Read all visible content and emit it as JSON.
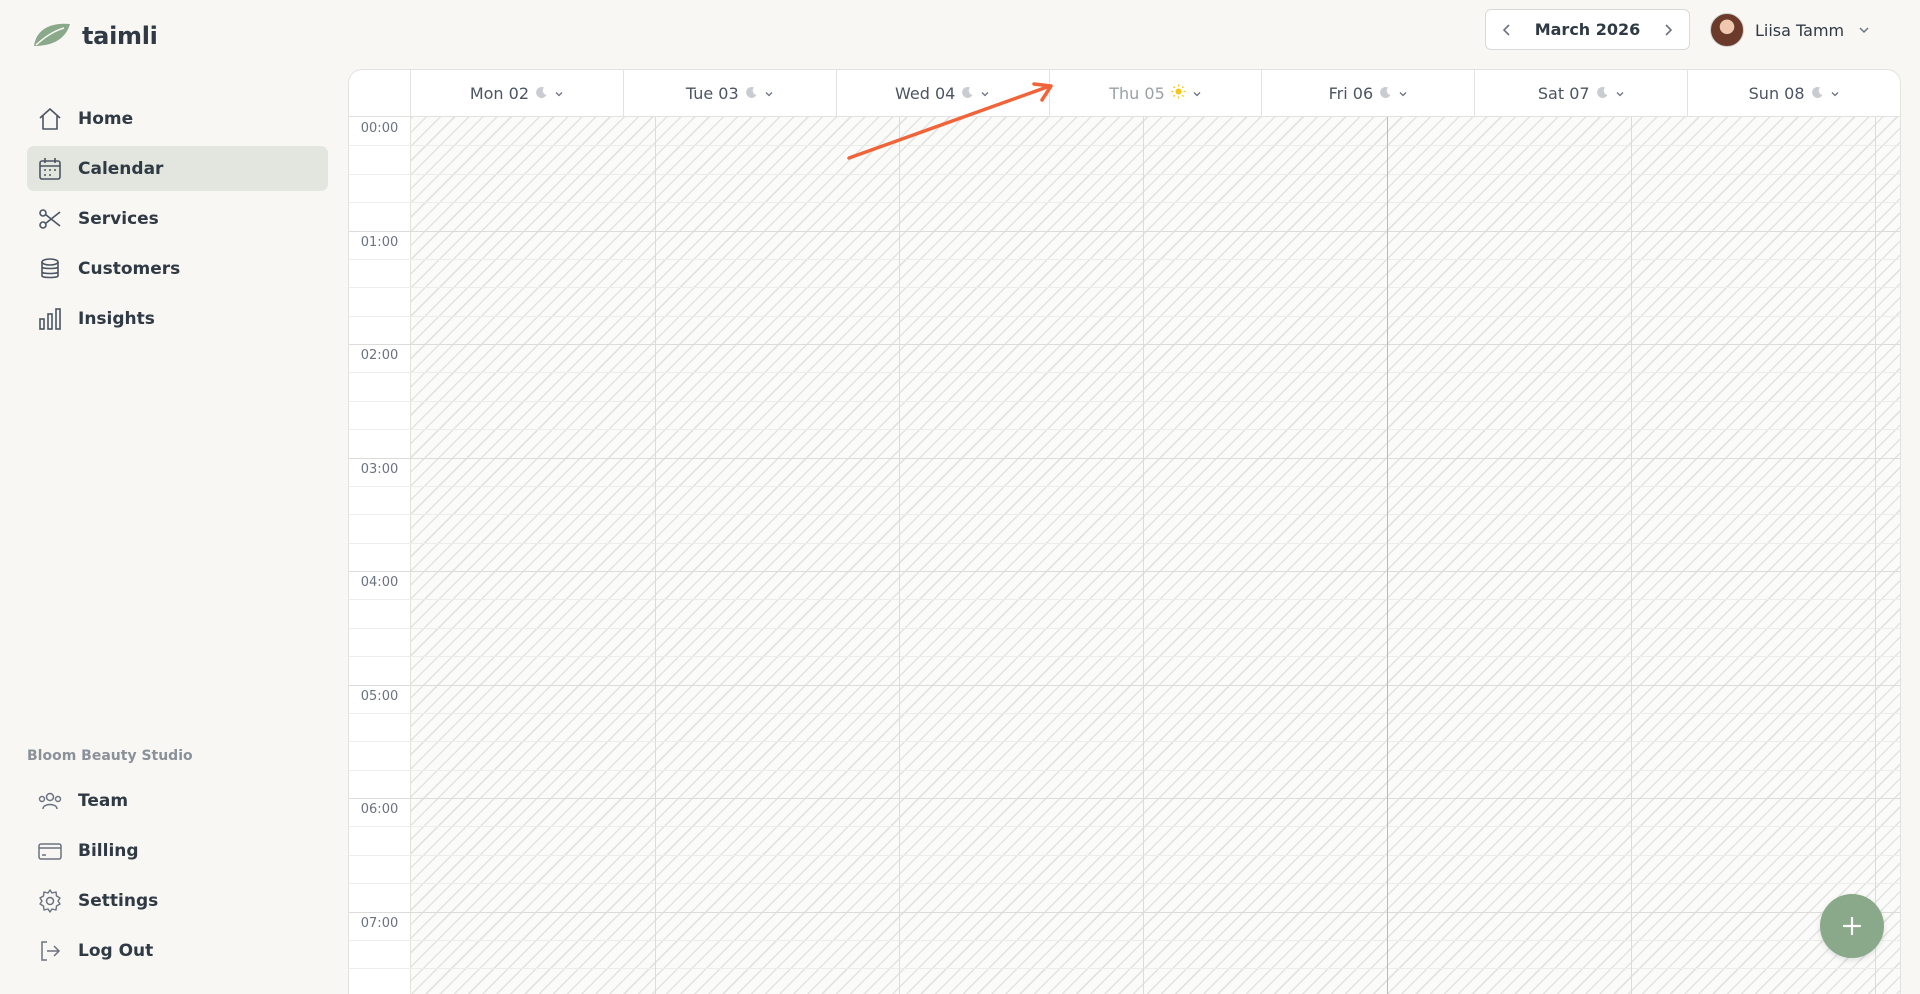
{
  "app": {
    "name": "taimli"
  },
  "sidebar": {
    "main_items": [
      {
        "label": "Home",
        "icon": "home-icon"
      },
      {
        "label": "Calendar",
        "icon": "calendar-icon",
        "active": true
      },
      {
        "label": "Services",
        "icon": "scissors-icon"
      },
      {
        "label": "Customers",
        "icon": "database-icon"
      },
      {
        "label": "Insights",
        "icon": "bar-chart-icon"
      }
    ],
    "studio_name": "Bloom Beauty Studio",
    "bottom_items": [
      {
        "label": "Team",
        "icon": "team-icon"
      },
      {
        "label": "Billing",
        "icon": "credit-card-icon"
      },
      {
        "label": "Settings",
        "icon": "gear-icon"
      },
      {
        "label": "Log Out",
        "icon": "logout-icon"
      }
    ]
  },
  "header": {
    "month_label": "March 2026",
    "user_name": "Liisa Tamm"
  },
  "calendar": {
    "days": [
      {
        "label": "Mon 02",
        "icon": "moon-icon"
      },
      {
        "label": "Tue 03",
        "icon": "moon-icon"
      },
      {
        "label": "Wed 04",
        "icon": "moon-icon"
      },
      {
        "label": "Thu 05",
        "icon": "sun-icon",
        "today": true
      },
      {
        "label": "Fri 06",
        "icon": "moon-icon"
      },
      {
        "label": "Sat 07",
        "icon": "moon-icon"
      },
      {
        "label": "Sun 08",
        "icon": "moon-icon"
      }
    ],
    "hours": [
      "00:00",
      "01:00",
      "02:00",
      "03:00",
      "04:00",
      "05:00",
      "06:00",
      "07:00"
    ]
  },
  "colors": {
    "accent": "#8aa88a",
    "arrow": "#f0643a",
    "active_nav": "#e3e6df",
    "sun": "#f5c518"
  }
}
